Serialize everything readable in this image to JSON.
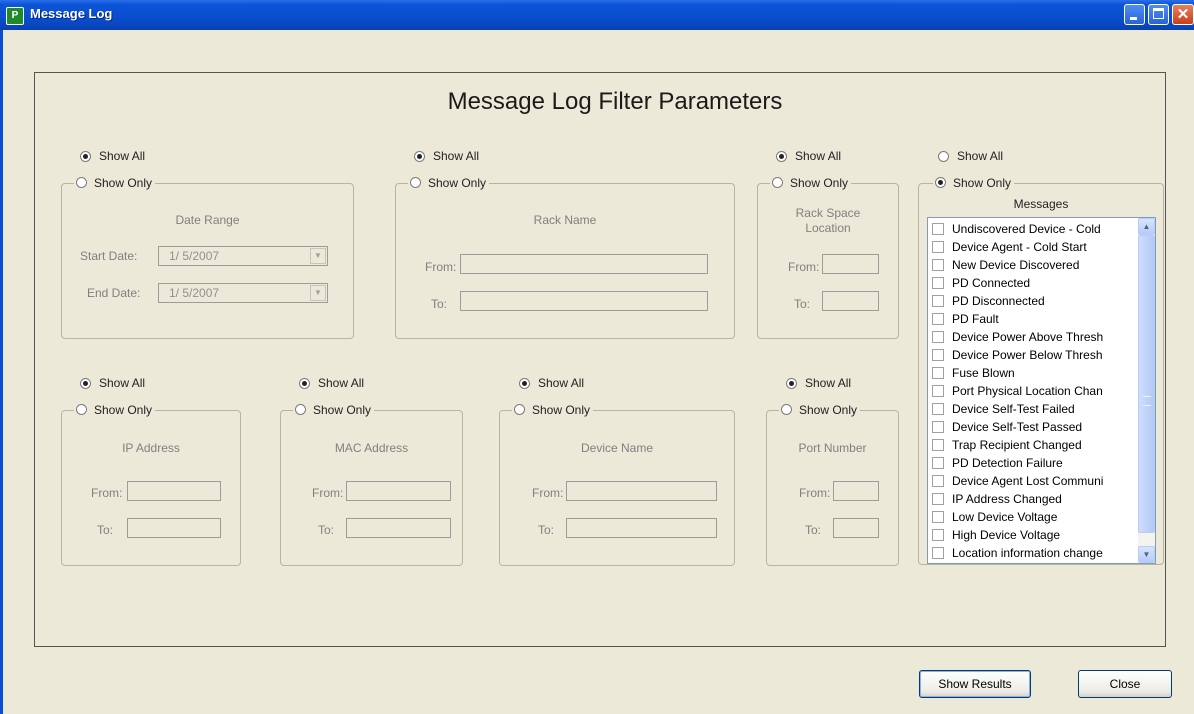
{
  "window": {
    "title": "Message Log",
    "icon": "app-logo-icon",
    "controls": [
      "minimize-icon",
      "maximize-icon",
      "close-icon"
    ]
  },
  "heading": "Message Log Filter Parameters",
  "common": {
    "show_all": "Show All",
    "show_only": "Show Only",
    "from": "From:",
    "to": "To:"
  },
  "date_filter": {
    "title": "Date Range",
    "start_label": "Start Date:",
    "start_value": "1/  5/2007",
    "end_label": "End Date:",
    "end_value": "1/  5/2007",
    "mode": "show_all"
  },
  "rack_name_filter": {
    "title": "Rack Name",
    "mode": "show_all"
  },
  "rack_space_filter": {
    "title_line1": "Rack Space",
    "title_line2": "Location",
    "mode": "show_all"
  },
  "ip_filter": {
    "title": "IP Address",
    "mode": "show_all"
  },
  "mac_filter": {
    "title": "MAC Address",
    "mode": "show_all"
  },
  "device_name_filter": {
    "title": "Device Name",
    "mode": "show_all"
  },
  "port_filter": {
    "title": "Port Number",
    "mode": "show_all"
  },
  "messages_filter": {
    "title": "Messages",
    "mode": "show_only",
    "items": [
      "Undiscovered Device - Cold",
      "Device Agent - Cold Start",
      "New Device Discovered",
      "PD Connected",
      "PD Disconnected",
      "PD Fault",
      "Device Power Above Thresh",
      "Device Power Below Thresh",
      "Fuse Blown",
      "Port Physical Location Chan",
      "Device Self-Test Failed",
      "Device Self-Test Passed",
      "Trap Recipient Changed",
      "PD Detection Failure",
      "Device Agent Lost Communi",
      "IP Address Changed",
      "Low Device Voltage",
      "High Device Voltage",
      "Location information change"
    ]
  },
  "buttons": {
    "show_results": "Show Results",
    "close": "Close"
  },
  "colors": {
    "titlebar": "#0a4fd0",
    "window_bg": "#ece9d8",
    "listbox_border": "#7f9db9",
    "scrollbar": "#b6cbf5"
  }
}
